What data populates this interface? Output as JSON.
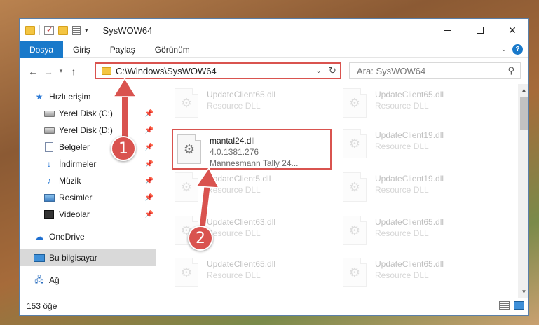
{
  "window": {
    "title": "SysWOW64"
  },
  "ribbon": {
    "tabs": [
      "Dosya",
      "Giriş",
      "Paylaş",
      "Görünüm"
    ]
  },
  "address": {
    "path": "C:\\Windows\\SysWOW64"
  },
  "search": {
    "placeholder": "Ara: SysWOW64"
  },
  "sidebar": {
    "items": [
      {
        "label": "Hızlı erişim"
      },
      {
        "label": "Yerel Disk (C:)"
      },
      {
        "label": "Yerel Disk (D:)"
      },
      {
        "label": "Belgeler"
      },
      {
        "label": "İndirmeler"
      },
      {
        "label": "Müzik"
      },
      {
        "label": "Resimler"
      },
      {
        "label": "Videolar"
      },
      {
        "label": "OneDrive"
      },
      {
        "label": "Bu bilgisayar"
      },
      {
        "label": "Ağ"
      }
    ]
  },
  "files": [
    {
      "name": "UpdateClient65.dll",
      "type": "Resource DLL"
    },
    {
      "name": "UpdateClient65.dll",
      "type": "Resource DLL"
    },
    {
      "name": "mantal24.dll",
      "version": "4.0.1381.276",
      "desc": "Mannesmann Tally 24..."
    },
    {
      "name": "UpdateClient19.dll",
      "type": "Resource DLL"
    },
    {
      "name": "UpdateClient5.dll",
      "type": "Resource DLL"
    },
    {
      "name": "UpdateClient19.dll",
      "type": "Resource DLL"
    },
    {
      "name": "UpdateClient63.dll",
      "type": "Resource DLL"
    },
    {
      "name": "UpdateClient65.dll",
      "type": "Resource DLL"
    },
    {
      "name": "UpdateClient65.dll",
      "type": "Resource DLL"
    },
    {
      "name": "UpdateClient65.dll",
      "type": "Resource DLL"
    }
  ],
  "status": {
    "count": "153 öğe"
  },
  "badges": {
    "one": "1",
    "two": "2"
  },
  "colors": {
    "accent": "#1979ca",
    "highlight": "#d9534f"
  }
}
